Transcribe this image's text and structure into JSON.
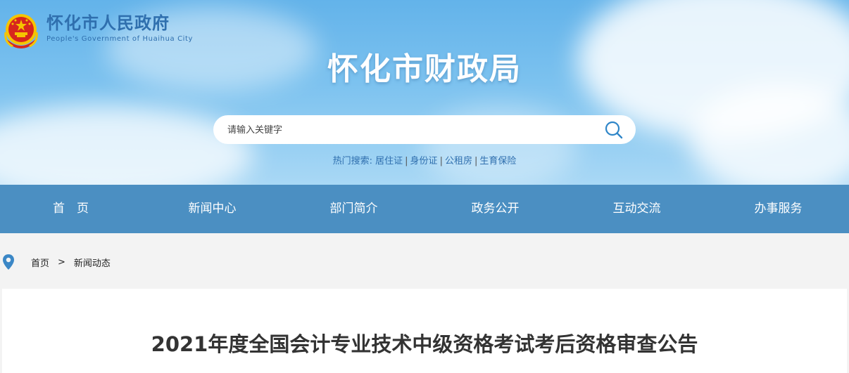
{
  "header": {
    "logo_cn": "怀化市人民政府",
    "logo_en": "People's Government of Huaihua City",
    "site_title": "怀化市财政局"
  },
  "search": {
    "placeholder": "请输入关键字",
    "icon": "search-icon",
    "hot_label": "热门搜索:",
    "hot_terms": [
      "居住证",
      "身份证",
      "公租房",
      "生育保险"
    ]
  },
  "nav": {
    "items": [
      "首　页",
      "新闻中心",
      "部门简介",
      "政务公开",
      "互动交流",
      "办事服务"
    ]
  },
  "breadcrumb": {
    "icon": "location-pin-icon",
    "home": "首页",
    "separator": ">",
    "current": "新闻动态"
  },
  "article": {
    "title": "2021年度全国会计专业技术中级资格考试考后资格审查公告"
  },
  "colors": {
    "nav_bg": "#4b8fc2",
    "brand_blue": "#2f6fae",
    "emblem_red": "#d7261e",
    "emblem_gold": "#f5c400"
  }
}
